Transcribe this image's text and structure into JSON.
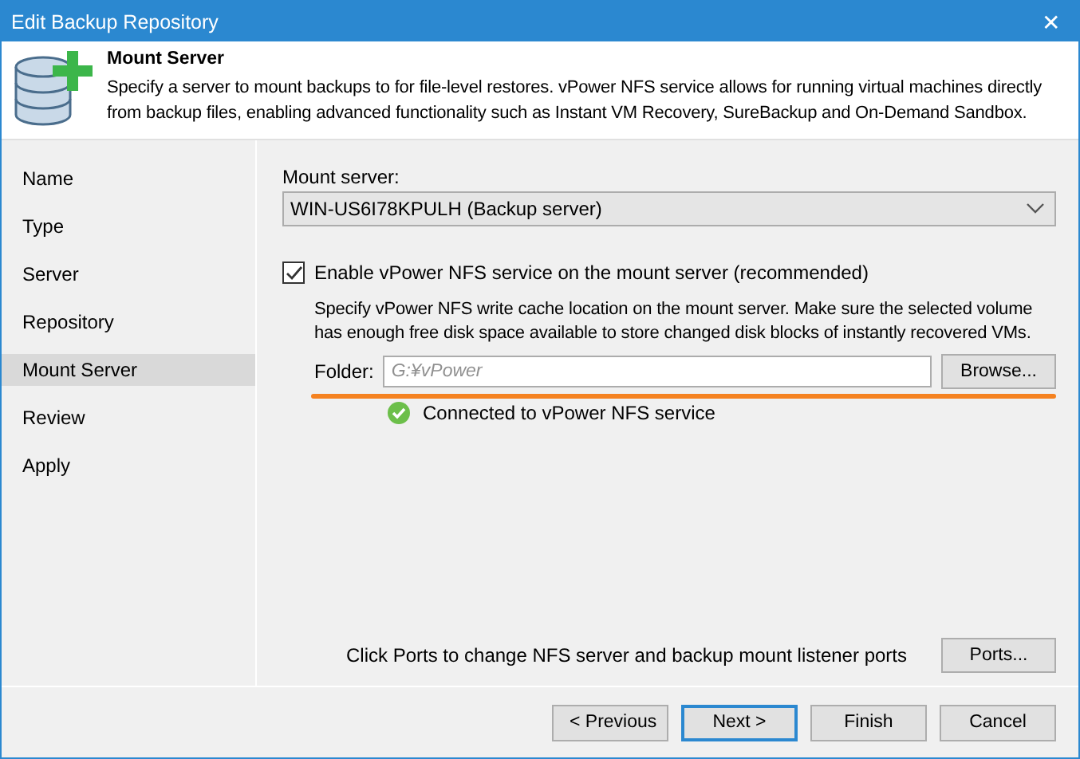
{
  "window": {
    "title": "Edit Backup Repository",
    "close": "✕"
  },
  "header": {
    "title": "Mount Server",
    "description": "Specify a server to mount backups to for file-level restores. vPower NFS service allows for running virtual machines directly from backup files, enabling advanced functionality such as Instant VM Recovery, SureBackup and On-Demand Sandbox."
  },
  "sidebar": {
    "items": [
      {
        "label": "Name",
        "selected": false
      },
      {
        "label": "Type",
        "selected": false
      },
      {
        "label": "Server",
        "selected": false
      },
      {
        "label": "Repository",
        "selected": false
      },
      {
        "label": "Mount Server",
        "selected": true
      },
      {
        "label": "Review",
        "selected": false
      },
      {
        "label": "Apply",
        "selected": false
      }
    ]
  },
  "mount_server": {
    "label": "Mount server:",
    "value": "WIN-US6I78KPULH (Backup server)"
  },
  "enable_nfs": {
    "label": "Enable vPower NFS service on the mount server (recommended)",
    "checked": true
  },
  "nfs_hint": "Specify vPower NFS write cache location on the mount server. Make sure the selected volume has enough free disk space available to store changed disk blocks of instantly recovered VMs.",
  "folder": {
    "label": "Folder:",
    "placeholder": "G:¥vPower",
    "button": "Browse..."
  },
  "status": {
    "text": "Connected to vPower NFS service",
    "ok": true
  },
  "ports": {
    "text": "Click Ports to change NFS server and backup mount listener ports",
    "button": "Ports..."
  },
  "buttons": [
    {
      "label": "< Previous",
      "default": false
    },
    {
      "label": "Next >",
      "default": true
    },
    {
      "label": "Finish",
      "default": false
    },
    {
      "label": "Cancel",
      "default": false
    }
  ]
}
